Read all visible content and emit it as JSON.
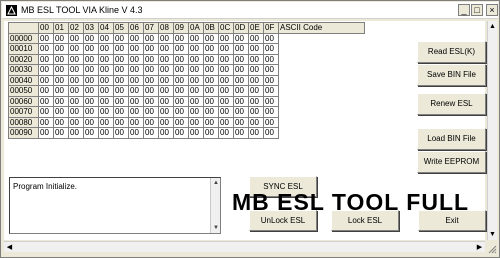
{
  "window": {
    "title": "MB ESL TOOL VIA Kline V 4.3",
    "min_glyph": "_",
    "max_glyph": "□",
    "close_glyph": "×"
  },
  "grid": {
    "header_corner": "",
    "columns": [
      "00",
      "01",
      "02",
      "03",
      "04",
      "05",
      "06",
      "07",
      "08",
      "09",
      "0A",
      "0B",
      "0C",
      "0D",
      "0E",
      "0F"
    ],
    "ascii_header": "ASCII Code",
    "rows": [
      {
        "addr": "00000",
        "cells": [
          "00",
          "00",
          "00",
          "00",
          "00",
          "00",
          "00",
          "00",
          "00",
          "00",
          "00",
          "00",
          "00",
          "00",
          "00",
          "00"
        ]
      },
      {
        "addr": "00010",
        "cells": [
          "00",
          "00",
          "00",
          "00",
          "00",
          "00",
          "00",
          "00",
          "00",
          "00",
          "00",
          "00",
          "00",
          "00",
          "00",
          "00"
        ]
      },
      {
        "addr": "00020",
        "cells": [
          "00",
          "00",
          "00",
          "00",
          "00",
          "00",
          "00",
          "00",
          "00",
          "00",
          "00",
          "00",
          "00",
          "00",
          "00",
          "00"
        ]
      },
      {
        "addr": "00030",
        "cells": [
          "00",
          "00",
          "00",
          "00",
          "00",
          "00",
          "00",
          "00",
          "00",
          "00",
          "00",
          "00",
          "00",
          "00",
          "00",
          "00"
        ]
      },
      {
        "addr": "00040",
        "cells": [
          "00",
          "00",
          "00",
          "00",
          "00",
          "00",
          "00",
          "00",
          "00",
          "00",
          "00",
          "00",
          "00",
          "00",
          "00",
          "00"
        ]
      },
      {
        "addr": "00050",
        "cells": [
          "00",
          "00",
          "00",
          "00",
          "00",
          "00",
          "00",
          "00",
          "00",
          "00",
          "00",
          "00",
          "00",
          "00",
          "00",
          "00"
        ]
      },
      {
        "addr": "00060",
        "cells": [
          "00",
          "00",
          "00",
          "00",
          "00",
          "00",
          "00",
          "00",
          "00",
          "00",
          "00",
          "00",
          "00",
          "00",
          "00",
          "00"
        ]
      },
      {
        "addr": "00070",
        "cells": [
          "00",
          "00",
          "00",
          "00",
          "00",
          "00",
          "00",
          "00",
          "00",
          "00",
          "00",
          "00",
          "00",
          "00",
          "00",
          "00"
        ]
      },
      {
        "addr": "00080",
        "cells": [
          "00",
          "00",
          "00",
          "00",
          "00",
          "00",
          "00",
          "00",
          "00",
          "00",
          "00",
          "00",
          "00",
          "00",
          "00",
          "00"
        ]
      },
      {
        "addr": "00090",
        "cells": [
          "00",
          "00",
          "00",
          "00",
          "00",
          "00",
          "00",
          "00",
          "00",
          "00",
          "00",
          "00",
          "00",
          "00",
          "00",
          "00"
        ]
      }
    ]
  },
  "buttons": {
    "read_esl": "Read ESL(K)",
    "save_bin": "Save BIN File",
    "renew_esl": "Renew ESL",
    "load_bin": "Load BIN File",
    "write_eeprom": "Write EEPROM",
    "sync_esl": "SYNC   ESL",
    "unlock_esl": "UnLock ESL",
    "lock_esl": "Lock ESL",
    "exit": "Exit"
  },
  "log": {
    "text": "Program Initialize."
  },
  "overlay": {
    "text": "MB ESL TOOL FULL"
  },
  "icons": {
    "app": "app-logo-icon",
    "scroll_left": "◀",
    "scroll_right": "▶",
    "scroll_up": "▲",
    "scroll_down": "▼"
  }
}
